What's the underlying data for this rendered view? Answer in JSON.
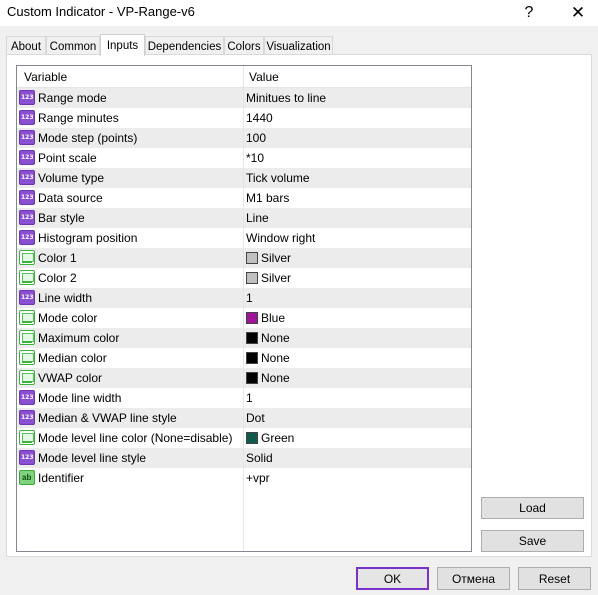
{
  "window": {
    "title": "Custom Indicator - VP-Range-v6",
    "help_label": "?",
    "close_label": "✕"
  },
  "tabs": [
    {
      "label": "About"
    },
    {
      "label": "Common"
    },
    {
      "label": "Inputs",
      "active": true
    },
    {
      "label": "Dependencies"
    },
    {
      "label": "Colors"
    },
    {
      "label": "Visualization"
    }
  ],
  "table": {
    "headers": {
      "variable": "Variable",
      "value": "Value"
    },
    "rows": [
      {
        "icon": "number-icon",
        "variable": "Range mode",
        "value": "Minitues to line"
      },
      {
        "icon": "number-icon",
        "variable": "Range minutes",
        "value": "1440"
      },
      {
        "icon": "number-icon",
        "variable": "Mode step (points)",
        "value": "100"
      },
      {
        "icon": "number-icon",
        "variable": "Point scale",
        "value": "*10"
      },
      {
        "icon": "number-icon",
        "variable": "Volume type",
        "value": "Tick volume"
      },
      {
        "icon": "number-icon",
        "variable": "Data source",
        "value": "M1 bars"
      },
      {
        "icon": "number-icon",
        "variable": "Bar style",
        "value": "Line"
      },
      {
        "icon": "number-icon",
        "variable": "Histogram position",
        "value": "Window right"
      },
      {
        "icon": "color-icon",
        "variable": "Color 1",
        "value": "Silver",
        "swatch": "#c0c0c0"
      },
      {
        "icon": "color-icon",
        "variable": "Color 2",
        "value": "Silver",
        "swatch": "#c0c0c0"
      },
      {
        "icon": "number-icon",
        "variable": "Line width",
        "value": "1"
      },
      {
        "icon": "color-icon",
        "variable": "Mode color",
        "value": "Blue",
        "swatch": "#a0149a"
      },
      {
        "icon": "color-icon",
        "variable": "Maximum color",
        "value": "None",
        "swatch": "#000000"
      },
      {
        "icon": "color-icon",
        "variable": "Median color",
        "value": "None",
        "swatch": "#000000"
      },
      {
        "icon": "color-icon",
        "variable": "VWAP color",
        "value": "None",
        "swatch": "#000000"
      },
      {
        "icon": "number-icon",
        "variable": "Mode line width",
        "value": "1"
      },
      {
        "icon": "number-icon",
        "variable": "Median & VWAP line style",
        "value": "Dot"
      },
      {
        "icon": "color-icon",
        "variable": "Mode level line color (None=disable)",
        "value": "Green",
        "swatch": "#0f5a4a"
      },
      {
        "icon": "number-icon",
        "variable": "Mode level line style",
        "value": "Solid"
      },
      {
        "icon": "string-icon",
        "variable": "Identifier",
        "value": "+vpr"
      }
    ]
  },
  "buttons": {
    "load": "Load",
    "save": "Save",
    "ok": "OK",
    "cancel": "Отмена",
    "reset": "Reset"
  },
  "colors": {
    "accent": "#7a33c8",
    "background": "#f0f0f0"
  }
}
